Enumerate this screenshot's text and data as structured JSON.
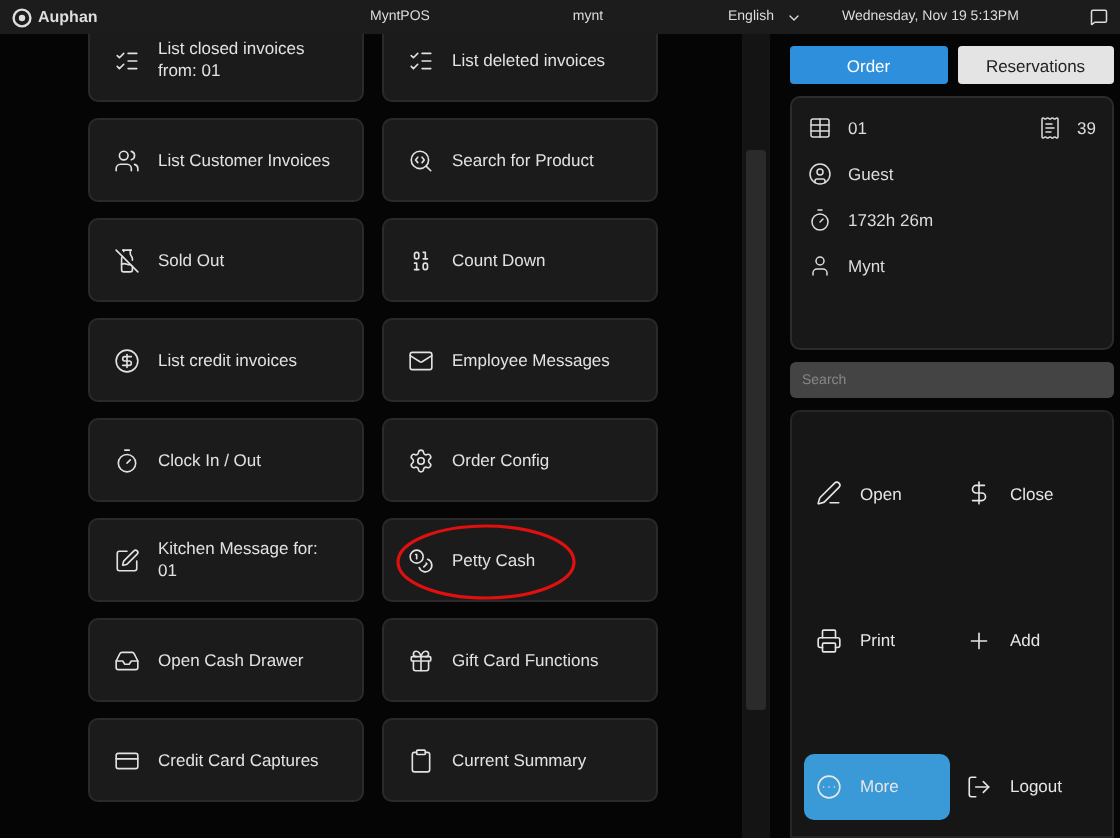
{
  "top_bar": {
    "logo_text": "Auphan",
    "app_name": "MyntPOS",
    "user": "mynt",
    "language": "English",
    "datetime": "Wednesday, Nov 19 5:13PM"
  },
  "functions": [
    {
      "label": "List closed invoices from: 01",
      "highlighted": false
    },
    {
      "label": "List deleted invoices",
      "highlighted": false
    },
    {
      "label": "List Customer Invoices",
      "highlighted": false
    },
    {
      "label": "Search for Product",
      "highlighted": false
    },
    {
      "label": "Sold Out",
      "highlighted": false
    },
    {
      "label": "Count Down",
      "highlighted": false
    },
    {
      "label": "List credit invoices",
      "highlighted": false
    },
    {
      "label": "Employee Messages",
      "highlighted": false
    },
    {
      "label": "Clock In / Out",
      "highlighted": false
    },
    {
      "label": "Order Config",
      "highlighted": false
    },
    {
      "label": "Kitchen Message for: 01",
      "highlighted": false
    },
    {
      "label": "Petty Cash",
      "highlighted": true
    },
    {
      "label": "Open Cash Drawer",
      "highlighted": false
    },
    {
      "label": "Gift Card Functions",
      "highlighted": false
    },
    {
      "label": "Credit Card Captures",
      "highlighted": false
    },
    {
      "label": "Current Summary",
      "highlighted": false
    }
  ],
  "tabs": [
    {
      "label": "Order",
      "selected": true
    },
    {
      "label": "Reservations",
      "selected": false
    }
  ],
  "order_info": {
    "table": "01",
    "count": "39",
    "guest": "Guest",
    "elapsed": "1732h 26m",
    "employee": "Mynt"
  },
  "search": {
    "placeholder": "Search"
  },
  "actions": [
    {
      "label": "Open",
      "selected": false
    },
    {
      "label": "Close",
      "selected": false
    },
    {
      "label": "Print",
      "selected": false
    },
    {
      "label": "Add",
      "selected": false
    },
    {
      "label": "More",
      "selected": true
    },
    {
      "label": "Logout",
      "selected": false
    }
  ]
}
